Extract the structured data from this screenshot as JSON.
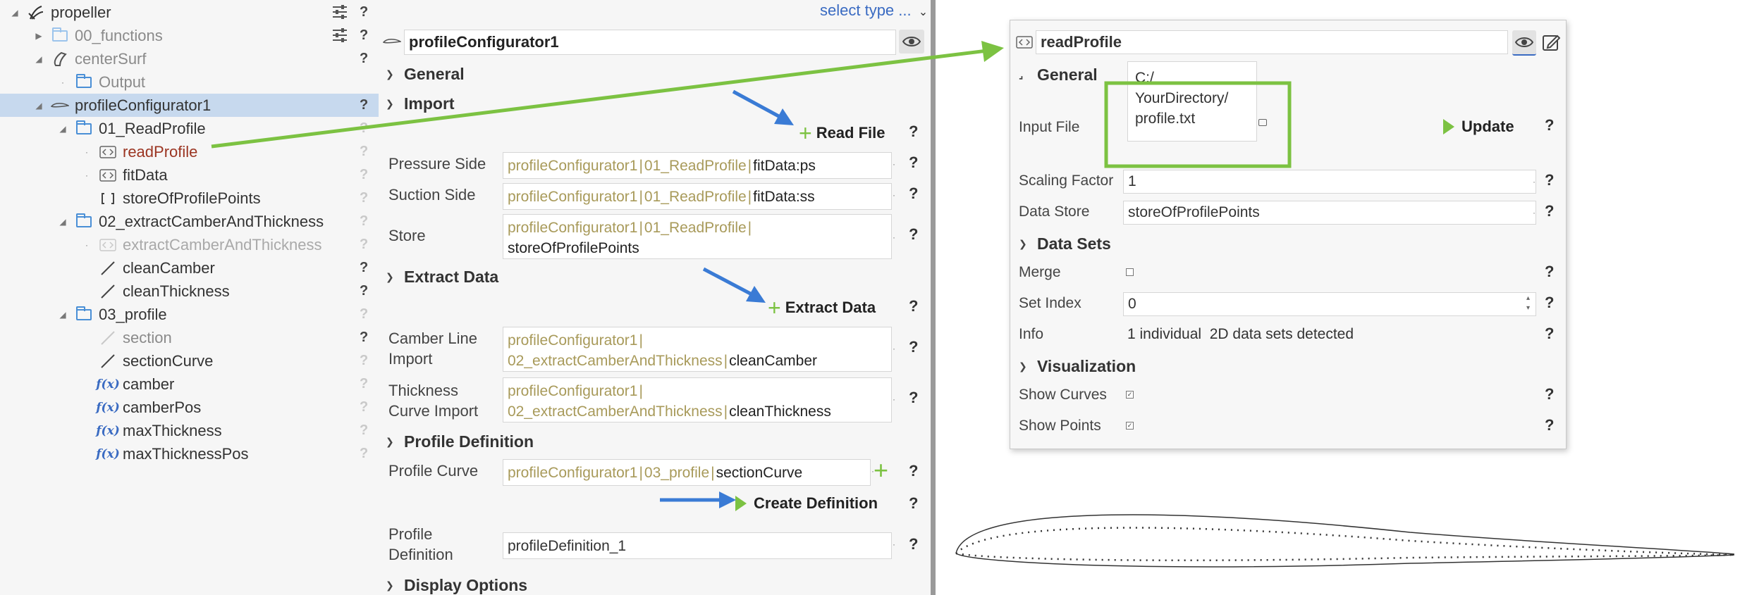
{
  "tree": {
    "items": [
      {
        "label": "propeller"
      },
      {
        "label": "00_functions"
      },
      {
        "label": "centerSurf"
      },
      {
        "label": "Output"
      },
      {
        "label": "profileConfigurator1"
      },
      {
        "label": "01_ReadProfile"
      },
      {
        "label": "readProfile"
      },
      {
        "label": "fitData"
      },
      {
        "label": "storeOfProfilePoints"
      },
      {
        "label": "02_extractCamberAndThickness"
      },
      {
        "label": "extractCamberAndThickness"
      },
      {
        "label": "cleanCamber"
      },
      {
        "label": "cleanThickness"
      },
      {
        "label": "03_profile"
      },
      {
        "label": "section"
      },
      {
        "label": "sectionCurve"
      },
      {
        "label": "camber"
      },
      {
        "label": "camberPos"
      },
      {
        "label": "maxThickness"
      },
      {
        "label": "maxThicknessPos"
      }
    ],
    "fx_glyph": "f(x)",
    "help": "?"
  },
  "mid": {
    "select_type": "select type ...",
    "object_name": "profileConfigurator1",
    "sections": {
      "general": "General",
      "import": "Import",
      "extract": "Extract Data",
      "profile_def": "Profile Definition",
      "display": "Display Options"
    },
    "read_file": "Read File",
    "extract_data": "Extract Data",
    "create_definition": "Create Definition",
    "pressure_side": {
      "label": "Pressure Side",
      "p1": "profileConfigurator1",
      "p2": "01_ReadProfile",
      "p3": "fitData:ps"
    },
    "suction_side": {
      "label": "Suction Side",
      "p1": "profileConfigurator1",
      "p2": "01_ReadProfile",
      "p3": "fitData:ss"
    },
    "store": {
      "label": "Store",
      "p1": "profileConfigurator1",
      "p2": "01_ReadProfile",
      "p3": "storeOfProfilePoints"
    },
    "camber_import": {
      "label1": "Camber Line",
      "label2": "Import",
      "p1": "profileConfigurator1",
      "p2": "02_extractCamberAndThickness",
      "p3": "cleanCamber"
    },
    "thickness_import": {
      "label1": "Thickness",
      "label2": "Curve Import",
      "p1": "profileConfigurator1",
      "p2": "02_extractCamberAndThickness",
      "p3": "cleanThickness"
    },
    "profile_curve": {
      "label": "Profile Curve",
      "p1": "profileConfigurator1",
      "p2": "03_profile",
      "p3": "sectionCurve"
    },
    "profile_definition": {
      "label1": "Profile",
      "label2": "Definition",
      "value": "profileDefinition_1"
    },
    "help": "?"
  },
  "dialog": {
    "title": "readProfile",
    "general": "General",
    "input_file": {
      "label": "Input File",
      "line1": "C:/",
      "line2": "YourDirectory/",
      "line3": "profile.txt"
    },
    "update": "Update",
    "scaling": {
      "label": "Scaling Factor",
      "value": "1"
    },
    "data_store": {
      "label": "Data Store",
      "value": "storeOfProfilePoints"
    },
    "data_sets": "Data Sets",
    "merge": {
      "label": "Merge"
    },
    "set_index": {
      "label": "Set Index",
      "value": "0"
    },
    "info": {
      "label": "Info",
      "value": "1 individual  2D data sets detected"
    },
    "visualization": "Visualization",
    "show_curves": {
      "label": "Show Curves"
    },
    "show_points": {
      "label": "Show Points"
    },
    "help": "?"
  },
  "colors": {
    "accent_green": "#7cc242",
    "arrow_blue": "#3a7bd5",
    "selection": "#c7d9ee",
    "path_olive": "#a89a5a"
  }
}
